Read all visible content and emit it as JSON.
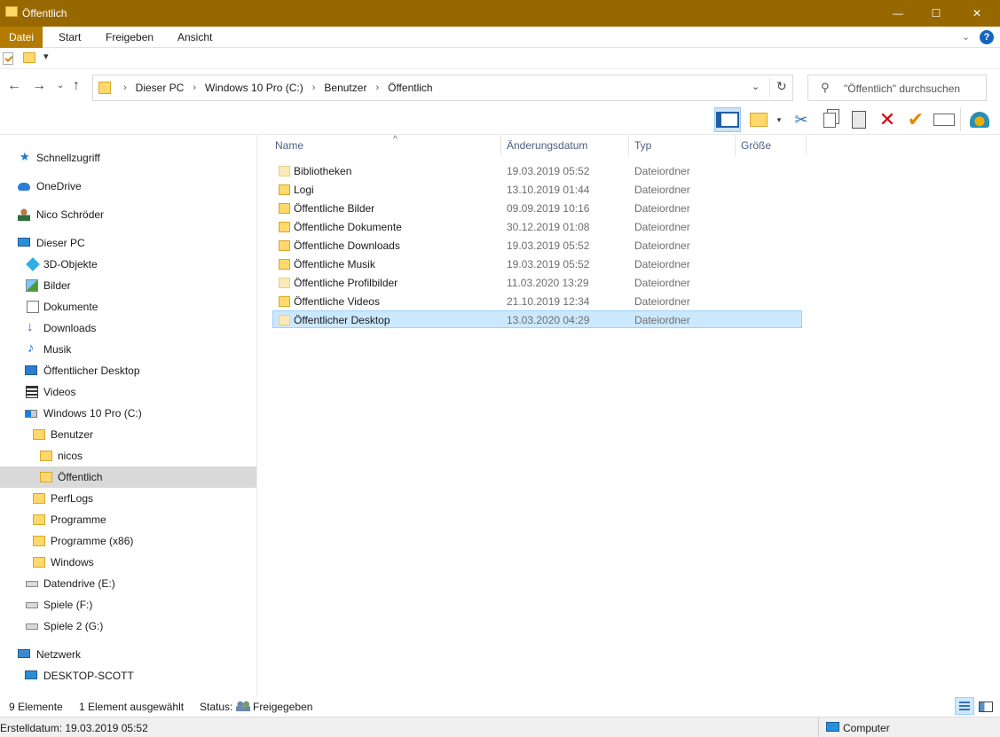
{
  "window": {
    "title": "Öffentlich",
    "minimize": "—",
    "maximize": "☐",
    "close": "✕"
  },
  "ribbon": {
    "tabs": [
      "Datei",
      "Start",
      "Freigeben",
      "Ansicht"
    ],
    "collapse_icon": "chevron-down-icon",
    "help": "?"
  },
  "qat": {
    "dropdown": "▾"
  },
  "nav": {
    "back": "←",
    "forward": "→",
    "recent": "⌄",
    "up": "↑"
  },
  "address": {
    "crumbs": [
      "Dieser PC",
      "Windows 10 Pro (C:)",
      "Benutzer",
      "Öffentlich"
    ],
    "separator": "›",
    "dropdown": "⌄",
    "refresh": "↻"
  },
  "search": {
    "placeholder": "\"Öffentlich\" durchsuchen",
    "icon": "⚲"
  },
  "toolbar": {
    "cut": "✂",
    "delete": "✕",
    "properties": "✔",
    "newfolder_dd": "▾"
  },
  "sidebar": {
    "items": [
      {
        "label": "Schnellzugriff",
        "icon": "star-icon"
      },
      {
        "label": "OneDrive",
        "icon": "cloud-icon"
      },
      {
        "label": "Nico Schröder",
        "icon": "user-icon"
      },
      {
        "label": "Dieser PC",
        "icon": "computer-icon"
      },
      {
        "label": "3D-Objekte",
        "icon": "3d-objects-icon"
      },
      {
        "label": "Bilder",
        "icon": "pictures-icon"
      },
      {
        "label": "Dokumente",
        "icon": "documents-icon"
      },
      {
        "label": "Downloads",
        "icon": "download-icon"
      },
      {
        "label": "Musik",
        "icon": "music-icon"
      },
      {
        "label": "Öffentlicher Desktop",
        "icon": "desktop-icon"
      },
      {
        "label": "Videos",
        "icon": "videos-icon"
      },
      {
        "label": "Windows 10 Pro (C:)",
        "icon": "system-drive-icon"
      },
      {
        "label": "Benutzer",
        "icon": "folder-icon"
      },
      {
        "label": "nicos",
        "icon": "folder-icon"
      },
      {
        "label": "Öffentlich",
        "icon": "folder-icon"
      },
      {
        "label": "PerfLogs",
        "icon": "folder-icon"
      },
      {
        "label": "Programme",
        "icon": "folder-icon"
      },
      {
        "label": "Programme (x86)",
        "icon": "folder-icon"
      },
      {
        "label": "Windows",
        "icon": "folder-icon"
      },
      {
        "label": "Datendrive (E:)",
        "icon": "drive-icon"
      },
      {
        "label": "Spiele (F:)",
        "icon": "drive-icon"
      },
      {
        "label": "Spiele 2 (G:)",
        "icon": "drive-icon"
      },
      {
        "label": "Netzwerk",
        "icon": "network-icon"
      },
      {
        "label": "DESKTOP-SCOTT",
        "icon": "computer-icon"
      }
    ],
    "selected": "Öffentlich"
  },
  "files": {
    "columns": [
      "Name",
      "Änderungsdatum",
      "Typ",
      "Größe"
    ],
    "sort_indicator": "^",
    "rows": [
      {
        "name": "Bibliotheken",
        "date": "19.03.2019 05:52",
        "type": "Dateiordner"
      },
      {
        "name": "Logi",
        "date": "13.10.2019 01:44",
        "type": "Dateiordner"
      },
      {
        "name": "Öffentliche Bilder",
        "date": "09.09.2019 10:16",
        "type": "Dateiordner"
      },
      {
        "name": "Öffentliche Dokumente",
        "date": "30.12.2019 01:08",
        "type": "Dateiordner"
      },
      {
        "name": "Öffentliche Downloads",
        "date": "19.03.2019 05:52",
        "type": "Dateiordner"
      },
      {
        "name": "Öffentliche Musik",
        "date": "19.03.2019 05:52",
        "type": "Dateiordner"
      },
      {
        "name": "Öffentliche Profilbilder",
        "date": "11.03.2020 13:29",
        "type": "Dateiordner"
      },
      {
        "name": "Öffentliche Videos",
        "date": "21.10.2019 12:34",
        "type": "Dateiordner"
      },
      {
        "name": "Öffentlicher Desktop",
        "date": "13.03.2020 04:29",
        "type": "Dateiordner"
      }
    ],
    "selected": "Öffentlicher Desktop"
  },
  "status": {
    "count": "9 Elemente",
    "selection": "1 Element ausgewählt",
    "status_label": "Status:",
    "status_value": "Freigegeben",
    "created": "Erstelldatum: 19.03.2019 05:52",
    "zone": "Computer"
  },
  "colors": {
    "titlebar": "#986800",
    "file_tab": "#b37c00",
    "selection": "#cce8ff",
    "nav_selected": "#d9d9d9"
  }
}
